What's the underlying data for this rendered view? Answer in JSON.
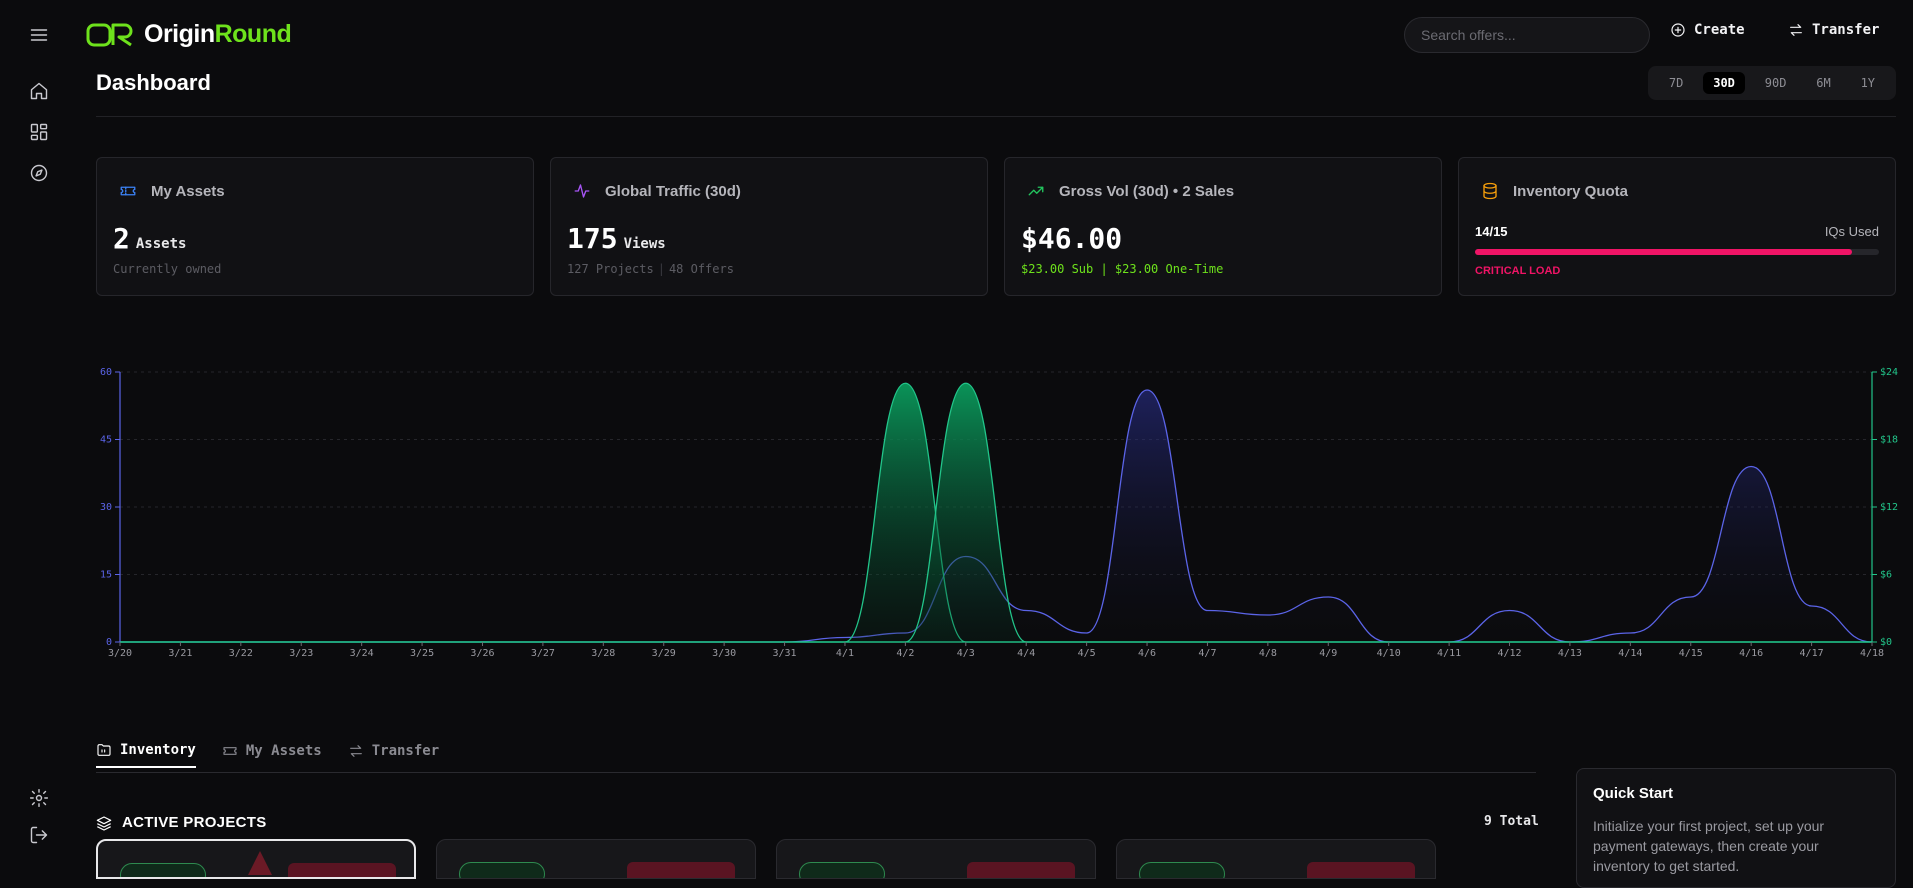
{
  "app": {
    "brand_origin": "Origin",
    "brand_round": "Round",
    "accent": "#6ee21c"
  },
  "header": {
    "search_placeholder": "Search offers...",
    "create_label": "Create",
    "transfer_label": "Transfer"
  },
  "sidebar": {
    "items": [
      "menu-icon",
      "home-icon",
      "dashboard-icon",
      "compass-icon"
    ],
    "bottom": [
      "settings-icon",
      "logout-icon"
    ]
  },
  "page": {
    "title": "Dashboard",
    "ranges": [
      "7D",
      "30D",
      "90D",
      "6M",
      "1Y"
    ],
    "active_range": "30D"
  },
  "cards": {
    "assets": {
      "title": "My Assets",
      "value": "2",
      "unit": "Assets",
      "sub": "Currently owned",
      "icon": "ticket-icon",
      "color": "#3b82f6"
    },
    "traffic": {
      "title": "Global Traffic (30d)",
      "value": "175",
      "unit": "Views",
      "sub_projects": "127 Projects",
      "sub_sep": "|",
      "sub_offers": "48 Offers",
      "icon": "activity-icon",
      "color": "#a855f7"
    },
    "gross": {
      "title": "Gross Vol (30d) • 2 Sales",
      "value": "$46.00",
      "sub": "$23.00 Sub | $23.00 One-Time",
      "icon": "trending-up-icon",
      "color": "#22c55e"
    },
    "quota": {
      "title": "Inventory Quota",
      "used": "14/15",
      "label": "IQs Used",
      "fraction": 0.933,
      "status": "CRITICAL LOAD",
      "icon": "database-icon",
      "color": "#f59e0b"
    }
  },
  "chart_data": {
    "type": "area",
    "x": [
      "3/20",
      "3/21",
      "3/22",
      "3/23",
      "3/24",
      "3/25",
      "3/26",
      "3/27",
      "3/28",
      "3/29",
      "3/30",
      "3/31",
      "4/1",
      "4/2",
      "4/3",
      "4/4",
      "4/5",
      "4/6",
      "4/7",
      "4/8",
      "4/9",
      "4/10",
      "4/11",
      "4/12",
      "4/13",
      "4/14",
      "4/15",
      "4/16",
      "4/17",
      "4/18"
    ],
    "y_left_ticks": [
      "0",
      "15",
      "30",
      "45",
      "60"
    ],
    "y_right_ticks": [
      "$0",
      "$6",
      "$12",
      "$18",
      "$24"
    ],
    "ylim_left": [
      0,
      60
    ],
    "ylim_right": [
      0,
      24
    ],
    "grid": true,
    "series": [
      {
        "axis": "left",
        "color": "#5b64e8",
        "values": [
          0,
          0,
          0,
          0,
          0,
          0,
          0,
          0,
          0,
          0,
          0,
          0,
          1,
          2,
          19,
          7,
          2,
          56,
          7,
          6,
          10,
          0,
          0,
          7,
          0,
          2,
          10,
          39,
          8,
          0
        ]
      },
      {
        "axis": "right",
        "color": "#22c58a",
        "values": [
          0,
          0,
          0,
          0,
          0,
          0,
          0,
          0,
          0,
          0,
          0,
          0,
          0,
          23,
          0,
          0,
          0,
          0,
          0,
          0,
          0,
          0,
          0,
          0,
          0,
          0,
          0,
          0,
          0,
          0
        ]
      },
      {
        "axis": "right",
        "color": "#22c58a",
        "values": [
          0,
          0,
          0,
          0,
          0,
          0,
          0,
          0,
          0,
          0,
          0,
          0,
          0,
          0,
          23,
          0,
          0,
          0,
          0,
          0,
          0,
          0,
          0,
          0,
          0,
          0,
          0,
          0,
          0,
          0
        ]
      }
    ]
  },
  "tabs": [
    {
      "label": "Inventory",
      "icon": "folder-icon",
      "active": true
    },
    {
      "label": "My Assets",
      "icon": "ticket-icon",
      "active": false
    },
    {
      "label": "Transfer",
      "icon": "transfer-icon",
      "active": false
    }
  ],
  "projects": {
    "title": "ACTIVE PROJECTS",
    "total": "9 Total"
  },
  "quickstart": {
    "title": "Quick Start",
    "text": "Initialize your first project, set up your payment gateways, then create your inventory to get started."
  }
}
